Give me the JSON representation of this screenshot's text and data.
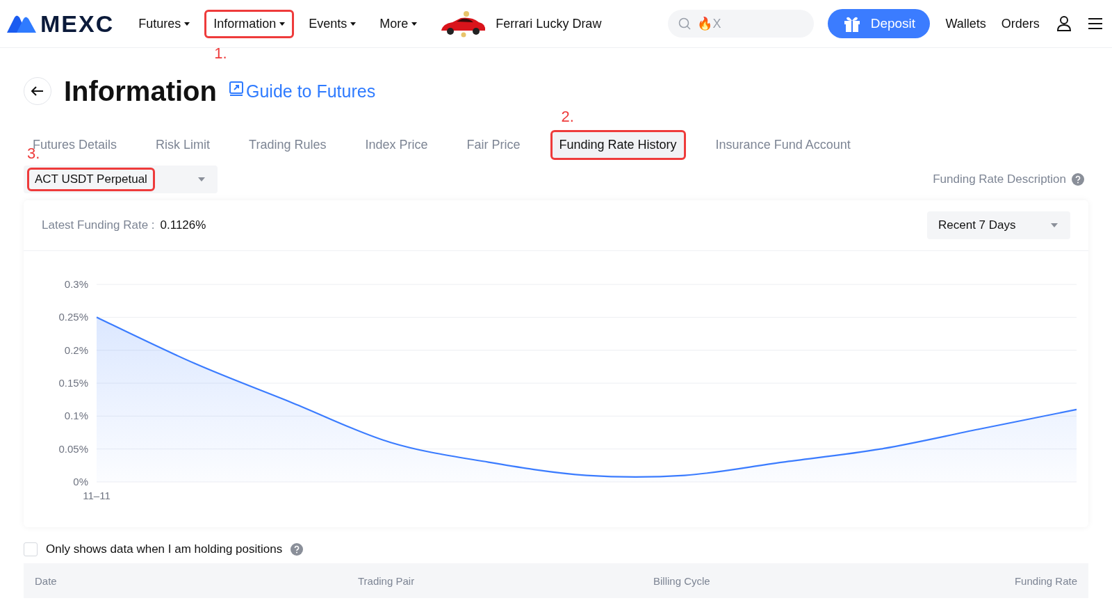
{
  "header": {
    "logo": "MEXC",
    "nav": [
      {
        "label": "Futures"
      },
      {
        "label": "Information",
        "callout": "1."
      },
      {
        "label": "Events"
      },
      {
        "label": "More"
      }
    ],
    "promo": "Ferrari Lucky Draw",
    "search": {
      "placeholder": "🔥X"
    },
    "deposit": "Deposit",
    "links": [
      "Wallets",
      "Orders"
    ]
  },
  "page": {
    "title": "Information",
    "guide_link": "Guide to Futures"
  },
  "tabs": [
    {
      "label": "Futures Details",
      "selected": false
    },
    {
      "label": "Risk Limit",
      "selected": false
    },
    {
      "label": "Trading Rules",
      "selected": false
    },
    {
      "label": "Index Price",
      "selected": false
    },
    {
      "label": "Fair Price",
      "selected": false
    },
    {
      "label": "Funding Rate History",
      "selected": true,
      "callout": "2."
    },
    {
      "label": "Insurance Fund Account",
      "selected": false
    }
  ],
  "contract_select": {
    "value": "ACT USDT Perpetual",
    "callout": "3."
  },
  "description_link": "Funding Rate Description",
  "card": {
    "latest_label": "Latest Funding Rate :",
    "latest_value": "0.1126%",
    "range_select": "Recent 7 Days",
    "chart_data": {
      "type": "area",
      "grid": true,
      "series": [
        {
          "color": "#3b7cff",
          "values": [
            0.25,
            0.18,
            0.12,
            0.06,
            0.03,
            0.01,
            0.01,
            0.03,
            0.05,
            0.08,
            0.11
          ]
        }
      ],
      "ylim": [
        0,
        0.3
      ],
      "yticks": [
        {
          "value": 0,
          "label": "0%"
        },
        {
          "value": 0.05,
          "label": "0.05%"
        },
        {
          "value": 0.1,
          "label": "0.1%"
        },
        {
          "value": 0.15,
          "label": "0.15%"
        },
        {
          "value": 0.2,
          "label": "0.2%"
        },
        {
          "value": 0.25,
          "label": "0.25%"
        },
        {
          "value": 0.3,
          "label": "0.3%"
        }
      ],
      "annotations": [
        "11–11"
      ]
    }
  },
  "holding_filter": {
    "label": "Only shows data when I am holding positions",
    "checked": false
  },
  "table": {
    "columns": [
      "Date",
      "Trading Pair",
      "Billing Cycle",
      "Funding Rate"
    ]
  }
}
